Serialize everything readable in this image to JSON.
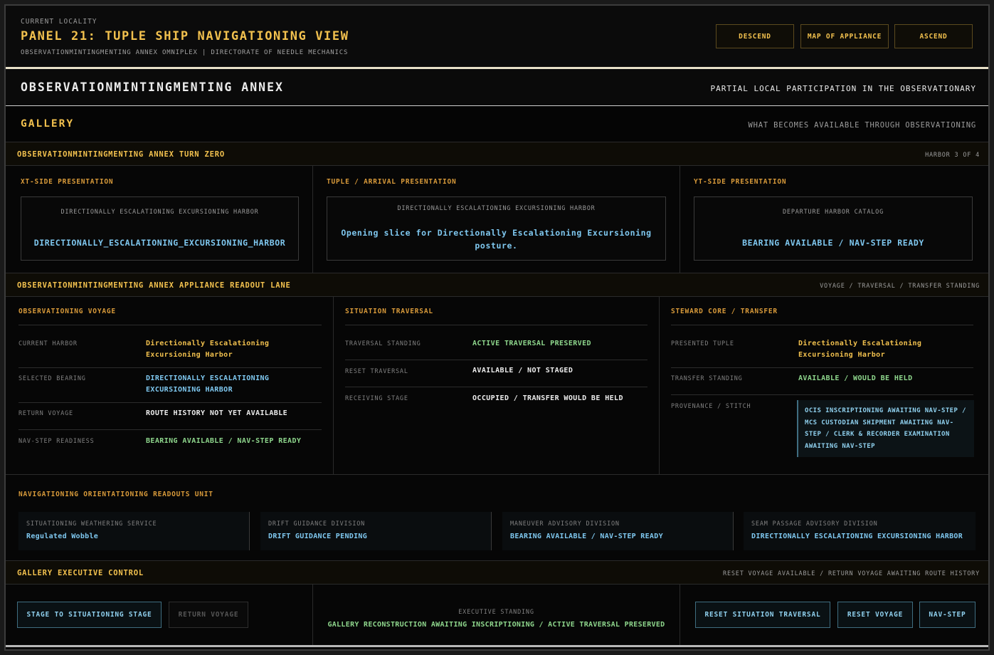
{
  "header": {
    "kicker": "CURRENT LOCALITY",
    "title": "PANEL 21: TUPLE SHIP NAVIGATIONING VIEW",
    "subtitle": "OBSERVATIONMINTINGMENTING ANNEX OMNIPLEX | DIRECTORATE OF NEEDLE MECHANICS",
    "buttons": {
      "descend": "DESCEND",
      "map": "MAP OF APPLIANCE",
      "ascend": "ASCEND"
    }
  },
  "annex": {
    "title": "OBSERVATIONMINTINGMENTING ANNEX",
    "right": "PARTIAL LOCAL PARTICIPATION IN THE OBSERVATIONARY"
  },
  "gallery": {
    "title": "GALLERY",
    "right": "WHAT BECOMES AVAILABLE THROUGH OBSERVATIONING"
  },
  "turn_zero": {
    "title": "OBSERVATIONMINTINGMENTING ANNEX TURN ZERO",
    "right": "HARBOR 3 OF 4",
    "xt": {
      "heading": "XT-SIDE PRESENTATION",
      "caption": "DIRECTIONALLY ESCALATIONING EXCURSIONING HARBOR",
      "value": "DIRECTIONALLY_ESCALATIONING_EXCURSIONING_HARBOR"
    },
    "tuple": {
      "heading": "TUPLE / ARRIVAL PRESENTATION",
      "caption": "DIRECTIONALLY ESCALATIONING EXCURSIONING HARBOR",
      "value": "Opening slice for Directionally Escalationing Excursioning posture."
    },
    "yt": {
      "heading": "YT-SIDE PRESENTATION",
      "caption": "DEPARTURE HARBOR CATALOG",
      "value": "BEARING AVAILABLE / NAV-STEP READY"
    }
  },
  "readout": {
    "title": "OBSERVATIONMINTINGMENTING ANNEX APPLIANCE READOUT LANE",
    "right": "VOYAGE / TRAVERSAL / TRANSFER STANDING",
    "voyage": {
      "heading": "OBSERVATIONING VOYAGE",
      "rows": [
        {
          "label": "CURRENT HARBOR",
          "value": "Directionally Escalationing Excursioning Harbor"
        },
        {
          "label": "SELECTED BEARING",
          "value": "DIRECTIONALLY ESCALATIONING EXCURSIONING HARBOR"
        },
        {
          "label": "RETURN VOYAGE",
          "value": "ROUTE HISTORY NOT YET AVAILABLE"
        },
        {
          "label": "NAV-STEP READINESS",
          "value": "BEARING AVAILABLE / NAV-STEP READY"
        }
      ]
    },
    "traversal": {
      "heading": "SITUATION TRAVERSAL",
      "rows": [
        {
          "label": "TRAVERSAL STANDING",
          "value": "ACTIVE TRAVERSAL PRESERVED"
        },
        {
          "label": "RESET TRAVERSAL",
          "value": "AVAILABLE / NOT STAGED"
        },
        {
          "label": "RECEIVING STAGE",
          "value": "OCCUPIED / TRANSFER WOULD BE HELD"
        }
      ]
    },
    "steward": {
      "heading": "STEWARD CORE / TRANSFER",
      "rows": [
        {
          "label": "PRESENTED TUPLE",
          "value": "Directionally Escalationing Excursioning Harbor"
        },
        {
          "label": "TRANSFER STANDING",
          "value": "AVAILABLE / WOULD BE HELD"
        },
        {
          "label": "PROVENANCE / STITCH",
          "value": "OCIS INSCRIPTIONING AWAITING NAV-STEP / MCS CUSTODIAN SHIPMENT AWAITING NAV-STEP / CLERK & RECORDER EXAMINATION AWAITING NAV-STEP"
        }
      ]
    }
  },
  "orientation": {
    "title": "NAVIGATIONING ORIENTATIONING READOUTS UNIT",
    "cells": [
      {
        "label": "SITUATIONING WEATHERING SERVICE",
        "value": "Regulated Wobble"
      },
      {
        "label": "DRIFT GUIDANCE DIVISION",
        "value": "DRIFT GUIDANCE PENDING"
      },
      {
        "label": "MANEUVER ADVISORY DIVISION",
        "value": "BEARING AVAILABLE / NAV-STEP READY"
      },
      {
        "label": "SEAM PASSAGE ADVISORY DIVISION",
        "value": "DIRECTIONALLY ESCALATIONING EXCURSIONING HARBOR"
      }
    ]
  },
  "executive": {
    "title": "GALLERY EXECUTIVE CONTROL",
    "right": "RESET VOYAGE AVAILABLE / RETURN VOYAGE AWAITING ROUTE HISTORY",
    "stage_button": "STAGE TO SITUATIONING STAGE",
    "return_button": "RETURN VOYAGE",
    "standing_label": "EXECUTIVE STANDING",
    "standing_value": "GALLERY RECONSTRUCTION AWAITING INSCRIPTIONING / ACTIVE TRAVERSAL PRESERVED",
    "reset_traversal_button": "RESET SITUATION TRAVERSAL",
    "reset_voyage_button": "RESET VOYAGE",
    "nav_step_button": "NAV-STEP"
  }
}
